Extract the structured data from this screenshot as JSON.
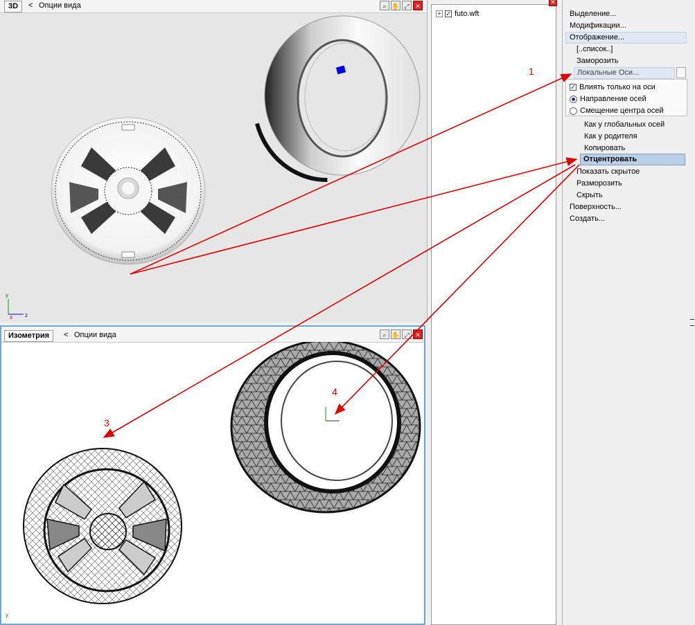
{
  "top_view": {
    "tab_label": "3D",
    "back_arrow": "<",
    "options_label": "Опции вида",
    "axis_y": "y",
    "axis_z": "z",
    "axis_x": "x"
  },
  "bottom_view": {
    "tab_label": "Изометрия",
    "back_arrow": "<",
    "options_label": "Опции вида",
    "axis_y": "y"
  },
  "tools": {
    "zoom_icon": "magnifier-icon",
    "pan_icon": "hand-icon",
    "fit_icon": "fit-icon",
    "close_icon": "close-icon"
  },
  "scene_tree": {
    "items": [
      {
        "label": "futo.wft",
        "checked": true
      }
    ]
  },
  "menu": {
    "items": {
      "selection": "Выделение...",
      "modification": "Модификации...",
      "display": "Отображение...",
      "list": "[..список..]",
      "freeze": "Заморозить",
      "local_axes": "Локальные Оси...",
      "affect_axes_only": "Влиять только на оси",
      "axes_direction": "Направление осей",
      "axes_center_offset": "Смещение центра осей",
      "like_global": "Как у глобальных осей",
      "like_parent": "Как у родителя",
      "copy": "Копировать",
      "center": "Отцентровать",
      "show_hidden": "Показать скрытое",
      "unfreeze": "Разморозить",
      "hide": "Скрыть",
      "surface": "Поверхность...",
      "create": "Создать..."
    },
    "radio_selected": "axes_direction"
  },
  "annotations": {
    "n1": "1",
    "n3": "3",
    "n4": "4"
  },
  "colors": {
    "arrow": "#e10000",
    "viewport_top_bg": "#e6e6e6",
    "viewport_bottom_bg": "#ffffff",
    "selected_item": "#b9cfe8"
  }
}
